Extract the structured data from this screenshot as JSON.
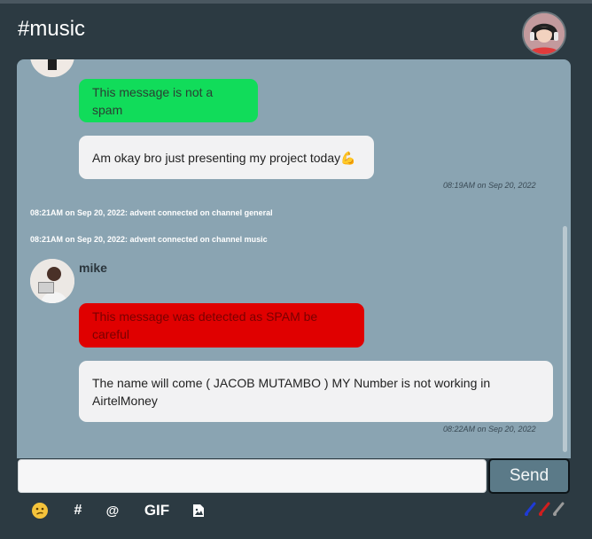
{
  "header": {
    "channel_title": "#music"
  },
  "messages": {
    "spam_ok_text": "This message is not a spam",
    "reply_text": "Am okay bro just presenting my project today",
    "reply_emoji": "💪",
    "reply_timestamp": "08:19AM on Sep 20, 2022",
    "system_1": "08:21AM on Sep 20, 2022: advent connected on channel general",
    "system_2": "08:21AM on Sep 20, 2022: advent connected on channel music",
    "sender_name": "mike",
    "spam_warning_text": "This message was detected as SPAM be careful",
    "mike_text": "The name will come ( JACOB MUTAMBO ) MY Number is not working in AirtelMoney",
    "mike_timestamp": "08:22AM on Sep 20, 2022"
  },
  "composer": {
    "input_value": "",
    "send_label": "Send"
  },
  "toolbar": {
    "hash_label": "#",
    "at_label": "@",
    "gif_label": "GIF"
  },
  "colors": {
    "background": "#2c3a42",
    "chat_panel": "#8aa4b2",
    "not_spam_bubble": "#11dc5a",
    "spam_bubble": "#e00000",
    "message_bubble": "#f2f2f3",
    "send_button": "#5b7a88",
    "brush_blue": "#1f3bd6",
    "brush_red": "#d11e1e",
    "brush_gray": "#9a9a9a"
  },
  "icons": [
    "user-avatar",
    "emoji-icon",
    "image-icon",
    "brush-icon"
  ]
}
